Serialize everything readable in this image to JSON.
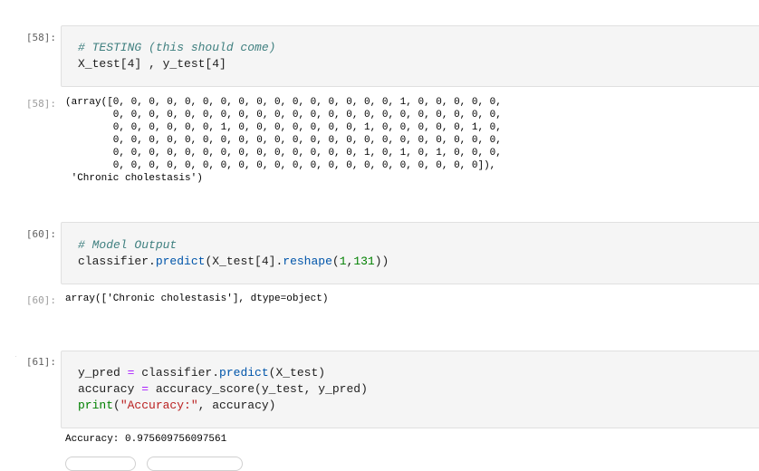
{
  "cells": [
    {
      "input_prompt": "[58]:",
      "output_prompt": "[58]:",
      "code_lines": [
        "# TESTING (this should come)",
        "X_test[4] , y_test[4]"
      ],
      "output_lines": [
        "(array([0, 0, 0, 0, 0, 0, 0, 0, 0, 0, 0, 0, 0, 0, 0, 0, 1, 0, 0, 0, 0, 0,",
        "        0, 0, 0, 0, 0, 0, 0, 0, 0, 0, 0, 0, 0, 0, 0, 0, 0, 0, 0, 0, 0, 0,",
        "        0, 0, 0, 0, 0, 0, 1, 0, 0, 0, 0, 0, 0, 0, 1, 0, 0, 0, 0, 0, 1, 0,",
        "        0, 0, 0, 0, 0, 0, 0, 0, 0, 0, 0, 0, 0, 0, 0, 0, 0, 0, 0, 0, 0, 0,",
        "        0, 0, 0, 0, 0, 0, 0, 0, 0, 0, 0, 0, 0, 0, 1, 0, 1, 0, 1, 0, 0, 0,",
        "        0, 0, 0, 0, 0, 0, 0, 0, 0, 0, 0, 0, 0, 0, 0, 0, 0, 0, 0, 0, 0]),",
        " 'Chronic cholestasis')"
      ]
    },
    {
      "input_prompt": "[60]:",
      "output_prompt": "[60]:",
      "comment": "# Model Output",
      "code_obj": "classifier.",
      "code_fn1": "predict",
      "code_mid": "(X_test[4].",
      "code_fn2": "reshape",
      "code_paren": "(",
      "code_n1": "1",
      "code_comma": ",",
      "code_n2": "131",
      "code_end": "))",
      "output_text": "array(['Chronic cholestasis'], dtype=object)"
    },
    {
      "input_prompt": "[61]:",
      "l1_var": "y_pred ",
      "l1_eq": "=",
      "l1_obj": " classifier.",
      "l1_fn": "predict",
      "l1_end": "(X_test)",
      "l2_var": "accuracy ",
      "l2_eq": "=",
      "l2_end": " accuracy_score(y_test, y_pred)",
      "l3_fn": "print",
      "l3_open": "(",
      "l3_str": "\"Accuracy:\"",
      "l3_end": ", accuracy)",
      "output_text": "Accuracy: 0.975609756097561"
    }
  ]
}
